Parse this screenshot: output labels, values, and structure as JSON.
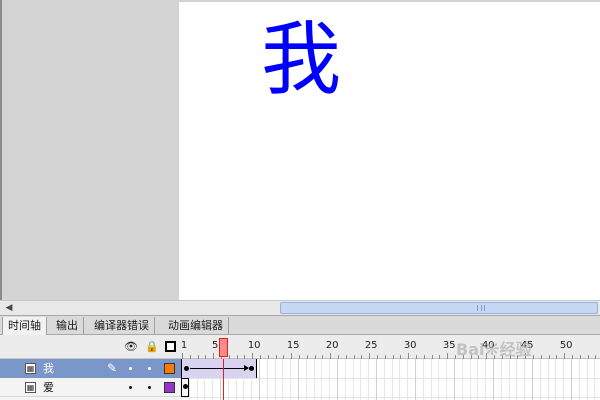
{
  "stage": {
    "glyph": "我",
    "glyph_color": "#0000ff"
  },
  "tabs": [
    {
      "label": "时间轴",
      "active": true
    },
    {
      "label": "输出",
      "active": false
    },
    {
      "label": "编译器错误",
      "active": false
    },
    {
      "label": "动画编辑器",
      "active": false
    }
  ],
  "timeline": {
    "header_icons": [
      "eye-icon",
      "lock-icon",
      "outline-icon"
    ],
    "ruler_labels": [
      "1",
      "5",
      "10",
      "15",
      "20",
      "25",
      "30",
      "35",
      "40",
      "45",
      "50"
    ],
    "current_frame": 6,
    "layers": [
      {
        "name": "我",
        "selected": true,
        "swatch_color": "#ff7a00",
        "editing": true
      },
      {
        "name": "爱",
        "selected": false,
        "swatch_color": "#9933cc",
        "editing": false
      }
    ]
  },
  "colors": {
    "selected_layer": "#7b97c9",
    "tween": "#d9d3f0",
    "playhead": "#e02020"
  },
  "watermark": {
    "text": "Bai",
    "text2": "经验"
  }
}
